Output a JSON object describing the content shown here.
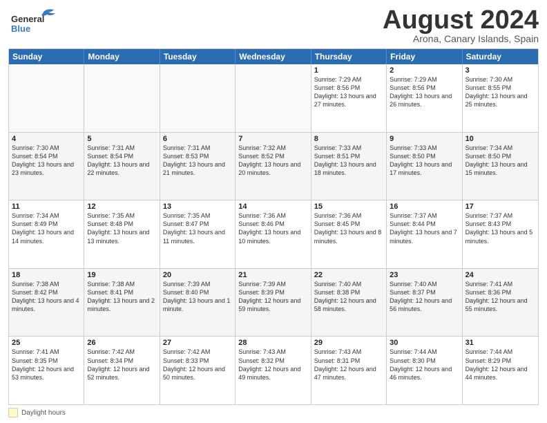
{
  "logo": {
    "line1": "General",
    "line2": "Blue"
  },
  "title": "August 2024",
  "subtitle": "Arona, Canary Islands, Spain",
  "header_days": [
    "Sunday",
    "Monday",
    "Tuesday",
    "Wednesday",
    "Thursday",
    "Friday",
    "Saturday"
  ],
  "footer": {
    "legend_label": "Daylight hours"
  },
  "rows": [
    [
      {
        "day": "",
        "text": "",
        "empty": true
      },
      {
        "day": "",
        "text": "",
        "empty": true
      },
      {
        "day": "",
        "text": "",
        "empty": true
      },
      {
        "day": "",
        "text": "",
        "empty": true
      },
      {
        "day": "1",
        "text": "Sunrise: 7:29 AM\nSunset: 8:56 PM\nDaylight: 13 hours and 27 minutes.",
        "empty": false
      },
      {
        "day": "2",
        "text": "Sunrise: 7:29 AM\nSunset: 8:56 PM\nDaylight: 13 hours and 26 minutes.",
        "empty": false
      },
      {
        "day": "3",
        "text": "Sunrise: 7:30 AM\nSunset: 8:55 PM\nDaylight: 13 hours and 25 minutes.",
        "empty": false
      }
    ],
    [
      {
        "day": "4",
        "text": "Sunrise: 7:30 AM\nSunset: 8:54 PM\nDaylight: 13 hours and 23 minutes.",
        "empty": false,
        "shaded": true
      },
      {
        "day": "5",
        "text": "Sunrise: 7:31 AM\nSunset: 8:54 PM\nDaylight: 13 hours and 22 minutes.",
        "empty": false,
        "shaded": true
      },
      {
        "day": "6",
        "text": "Sunrise: 7:31 AM\nSunset: 8:53 PM\nDaylight: 13 hours and 21 minutes.",
        "empty": false,
        "shaded": true
      },
      {
        "day": "7",
        "text": "Sunrise: 7:32 AM\nSunset: 8:52 PM\nDaylight: 13 hours and 20 minutes.",
        "empty": false,
        "shaded": true
      },
      {
        "day": "8",
        "text": "Sunrise: 7:33 AM\nSunset: 8:51 PM\nDaylight: 13 hours and 18 minutes.",
        "empty": false,
        "shaded": true
      },
      {
        "day": "9",
        "text": "Sunrise: 7:33 AM\nSunset: 8:50 PM\nDaylight: 13 hours and 17 minutes.",
        "empty": false,
        "shaded": true
      },
      {
        "day": "10",
        "text": "Sunrise: 7:34 AM\nSunset: 8:50 PM\nDaylight: 13 hours and 15 minutes.",
        "empty": false,
        "shaded": true
      }
    ],
    [
      {
        "day": "11",
        "text": "Sunrise: 7:34 AM\nSunset: 8:49 PM\nDaylight: 13 hours and 14 minutes.",
        "empty": false
      },
      {
        "day": "12",
        "text": "Sunrise: 7:35 AM\nSunset: 8:48 PM\nDaylight: 13 hours and 13 minutes.",
        "empty": false
      },
      {
        "day": "13",
        "text": "Sunrise: 7:35 AM\nSunset: 8:47 PM\nDaylight: 13 hours and 11 minutes.",
        "empty": false
      },
      {
        "day": "14",
        "text": "Sunrise: 7:36 AM\nSunset: 8:46 PM\nDaylight: 13 hours and 10 minutes.",
        "empty": false
      },
      {
        "day": "15",
        "text": "Sunrise: 7:36 AM\nSunset: 8:45 PM\nDaylight: 13 hours and 8 minutes.",
        "empty": false
      },
      {
        "day": "16",
        "text": "Sunrise: 7:37 AM\nSunset: 8:44 PM\nDaylight: 13 hours and 7 minutes.",
        "empty": false
      },
      {
        "day": "17",
        "text": "Sunrise: 7:37 AM\nSunset: 8:43 PM\nDaylight: 13 hours and 5 minutes.",
        "empty": false
      }
    ],
    [
      {
        "day": "18",
        "text": "Sunrise: 7:38 AM\nSunset: 8:42 PM\nDaylight: 13 hours and 4 minutes.",
        "empty": false,
        "shaded": true
      },
      {
        "day": "19",
        "text": "Sunrise: 7:38 AM\nSunset: 8:41 PM\nDaylight: 13 hours and 2 minutes.",
        "empty": false,
        "shaded": true
      },
      {
        "day": "20",
        "text": "Sunrise: 7:39 AM\nSunset: 8:40 PM\nDaylight: 13 hours and 1 minute.",
        "empty": false,
        "shaded": true
      },
      {
        "day": "21",
        "text": "Sunrise: 7:39 AM\nSunset: 8:39 PM\nDaylight: 12 hours and 59 minutes.",
        "empty": false,
        "shaded": true
      },
      {
        "day": "22",
        "text": "Sunrise: 7:40 AM\nSunset: 8:38 PM\nDaylight: 12 hours and 58 minutes.",
        "empty": false,
        "shaded": true
      },
      {
        "day": "23",
        "text": "Sunrise: 7:40 AM\nSunset: 8:37 PM\nDaylight: 12 hours and 56 minutes.",
        "empty": false,
        "shaded": true
      },
      {
        "day": "24",
        "text": "Sunrise: 7:41 AM\nSunset: 8:36 PM\nDaylight: 12 hours and 55 minutes.",
        "empty": false,
        "shaded": true
      }
    ],
    [
      {
        "day": "25",
        "text": "Sunrise: 7:41 AM\nSunset: 8:35 PM\nDaylight: 12 hours and 53 minutes.",
        "empty": false
      },
      {
        "day": "26",
        "text": "Sunrise: 7:42 AM\nSunset: 8:34 PM\nDaylight: 12 hours and 52 minutes.",
        "empty": false
      },
      {
        "day": "27",
        "text": "Sunrise: 7:42 AM\nSunset: 8:33 PM\nDaylight: 12 hours and 50 minutes.",
        "empty": false
      },
      {
        "day": "28",
        "text": "Sunrise: 7:43 AM\nSunset: 8:32 PM\nDaylight: 12 hours and 49 minutes.",
        "empty": false
      },
      {
        "day": "29",
        "text": "Sunrise: 7:43 AM\nSunset: 8:31 PM\nDaylight: 12 hours and 47 minutes.",
        "empty": false
      },
      {
        "day": "30",
        "text": "Sunrise: 7:44 AM\nSunset: 8:30 PM\nDaylight: 12 hours and 46 minutes.",
        "empty": false
      },
      {
        "day": "31",
        "text": "Sunrise: 7:44 AM\nSunset: 8:29 PM\nDaylight: 12 hours and 44 minutes.",
        "empty": false
      }
    ]
  ]
}
